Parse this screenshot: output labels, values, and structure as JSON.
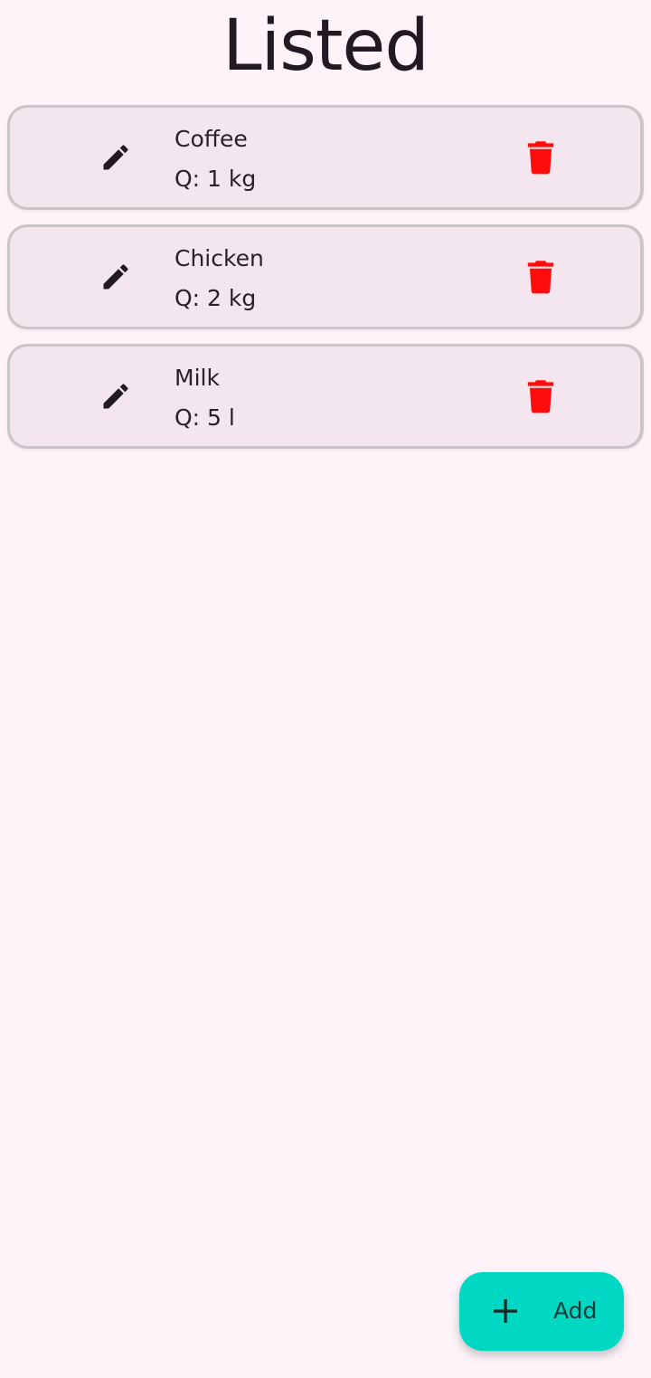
{
  "header": {
    "title": "Listed"
  },
  "items": [
    {
      "name": "Coffee",
      "quantity": "Q: 1 kg"
    },
    {
      "name": "Chicken",
      "quantity": "Q: 2 kg"
    },
    {
      "name": "Milk",
      "quantity": "Q: 5 l"
    }
  ],
  "fab": {
    "label": "Add",
    "icon": "plus-icon"
  },
  "icons": {
    "edit": "pencil-icon",
    "delete": "trash-icon"
  },
  "colors": {
    "background": "#fdf3f9",
    "card": "#f3e6ee",
    "delete": "#ff0d0d",
    "fab": "#00d8c4"
  }
}
